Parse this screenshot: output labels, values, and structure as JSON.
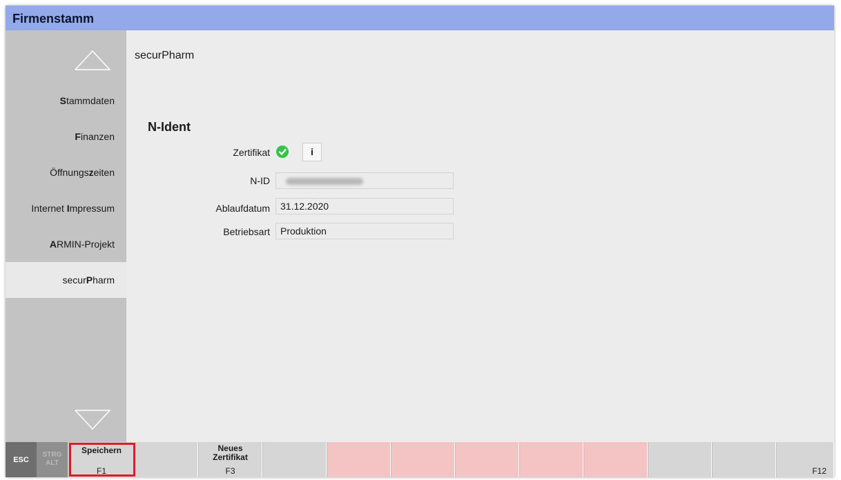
{
  "window": {
    "title": "Firmenstamm"
  },
  "sidebar": {
    "items": [
      {
        "bold": "S",
        "rest": "tammdaten",
        "active": false
      },
      {
        "bold": "F",
        "rest": "inanzen",
        "active": false
      },
      {
        "pre": "Öffnungs",
        "bold": "z",
        "rest": "eiten",
        "active": false
      },
      {
        "pre": "Internet ",
        "bold": "I",
        "rest": "mpressum",
        "active": false
      },
      {
        "bold": "A",
        "rest": "RMIN-Projekt",
        "active": false
      },
      {
        "pre": "secur",
        "bold": "P",
        "rest": "harm",
        "active": true
      }
    ]
  },
  "main": {
    "page_title": "securPharm",
    "section_title": "N-Ident",
    "fields": {
      "zertifikat_label": "Zertifikat",
      "info_label": "i",
      "nid_label": "N-ID",
      "nid_value": "",
      "ablaufdatum_label": "Ablaufdatum",
      "ablaufdatum_value": "31.12.2020",
      "betriebsart_label": "Betriebsart",
      "betriebsart_value": "Produktion"
    },
    "zertifikat_status": "valid"
  },
  "fnbar": {
    "esc": "ESC",
    "strg": "STRG",
    "alt": "ALT",
    "f1_label": "Speichern",
    "f1_key": "F1",
    "f3_label_line1": "Neues",
    "f3_label_line2": "Zertifikat",
    "f3_key": "F3",
    "f12_key": "F12"
  },
  "colors": {
    "titlebar": "#93a9ea",
    "sidebar": "#c3c3c3",
    "content": "#ececec",
    "fkey_pink": "#f4c4c4",
    "highlight": "#e01b24",
    "check": "#34c349"
  }
}
